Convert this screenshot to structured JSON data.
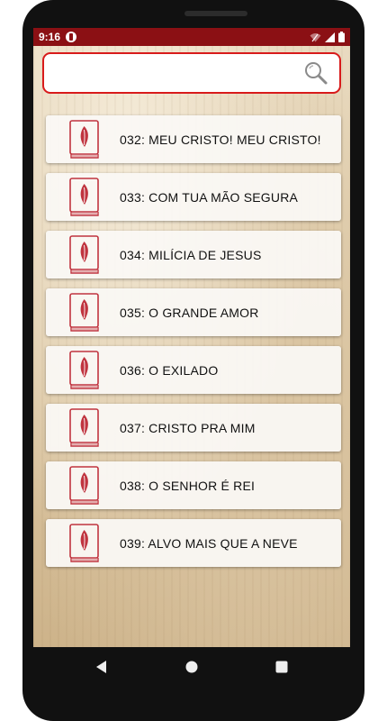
{
  "status_bar": {
    "time": "9:16",
    "icons": [
      "notification-icon",
      "wifi-icon",
      "signal-icon",
      "battery-icon"
    ],
    "color": "#8b1014"
  },
  "search": {
    "value": "",
    "placeholder": "",
    "border_color": "#d81b1b"
  },
  "hymns": [
    {
      "label": "032: MEU CRISTO! MEU CRISTO!"
    },
    {
      "label": "033: COM TUA MÃO SEGURA"
    },
    {
      "label": "034: MILÍCIA DE JESUS"
    },
    {
      "label": "035: O GRANDE AMOR"
    },
    {
      "label": "036: O EXILADO"
    },
    {
      "label": "037: CRISTO PRA MIM"
    },
    {
      "label": "038: O SENHOR É REI"
    },
    {
      "label": "039: ALVO MAIS QUE A NEVE"
    }
  ],
  "accent_color": "#c0343f",
  "nav": {
    "buttons": [
      "back-icon",
      "home-icon",
      "recents-icon"
    ]
  }
}
